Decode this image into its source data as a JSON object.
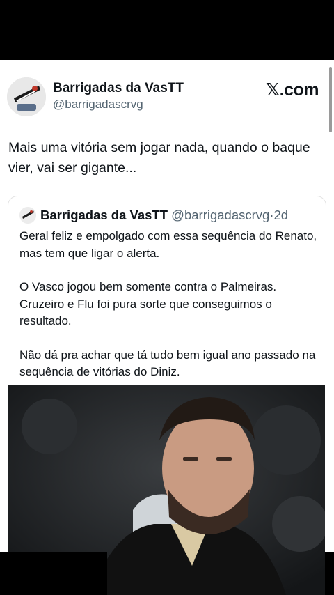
{
  "tweet": {
    "author_name": "Barrigadas da VasTT",
    "author_handle": "@barrigadascrvg",
    "brand": "𝕏.com",
    "text": "Mais uma vitória sem jogar nada, quando o baque vier, vai ser gigante..."
  },
  "quoted": {
    "author_name": "Barrigadas da VasTT",
    "author_handle": "@barrigadascrvg",
    "separator": "·",
    "age": "2d",
    "paragraphs": [
      "Geral feliz e empolgado com essa sequência do Renato, mas tem que ligar o alerta.",
      "O Vasco jogou bem somente contra o Palmeiras. Cruzeiro e Flu foi pura sorte que conseguimos o resultado.",
      "Não dá pra achar que tá tudo bem igual ano passado na sequência de vitórias do Diniz."
    ]
  },
  "colors": {
    "text": "#0f1419",
    "secondary": "#536471",
    "background": "#ffffff"
  },
  "icons": {
    "avatar": "vasco-crest-avatar",
    "brand": "x-logo"
  }
}
